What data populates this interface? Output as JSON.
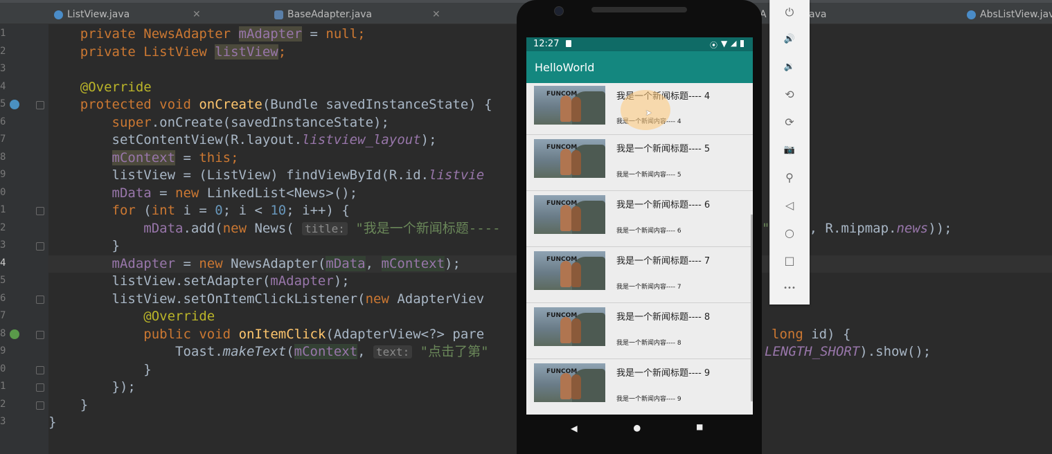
{
  "tabs": [
    {
      "label": "ListView.java",
      "icon": "class-icon"
    },
    {
      "label": "BaseAdapter.java",
      "icon": "interface-icon"
    },
    {
      "label": "A",
      "icon": "class-icon"
    },
    {
      "label": "ava",
      "icon": ""
    },
    {
      "label": "AbsListView.java",
      "icon": "class-icon"
    }
  ],
  "line_numbers": [
    "1",
    "2",
    "3",
    "4",
    "5",
    "6",
    "7",
    "8",
    "9",
    "0",
    "1",
    "2",
    "3",
    "4",
    "5",
    "6",
    "7",
    "8",
    "9",
    "0",
    "1",
    "2",
    "3"
  ],
  "code": {
    "l1_a": "    private NewsAdapter ",
    "l1_b": "mAdapter",
    "l1_c": " = ",
    "l1_d": "null",
    "l1_e": ";",
    "l2_a": "    private ListView ",
    "l2_b": "listView",
    "l2_c": ";",
    "l4": "    @Override",
    "l5_a": "    protected void ",
    "l5_b": "onCreate",
    "l5_c": "(Bundle savedInstanceState) {",
    "l6_a": "        ",
    "l6_b": "super",
    "l6_c": ".onCreate(savedInstanceState);",
    "l7_a": "        setContentView(R.layout.",
    "l7_b": "listview_layout",
    "l7_c": ");",
    "l8_a": "        ",
    "l8_b": "mContext",
    "l8_c": " = ",
    "l8_d": "this",
    "l8_e": ";",
    "l9_a": "        listView = (ListView) findViewById(R.id.",
    "l9_b": "listvie",
    "l10_a": "        ",
    "l10_b": "mData",
    "l10_c": " = ",
    "l10_d": "new",
    "l10_e": " LinkedList<News>();",
    "l11_a": "        ",
    "l11_b": "for",
    "l11_c": " (",
    "l11_d": "int",
    "l11_e": " i = ",
    "l11_f": "0",
    "l11_g": "; i < ",
    "l11_h": "10",
    "l11_i": "; i++) {",
    "l12_a": "            ",
    "l12_b": "mData",
    "l12_c": ".add(",
    "l12_d": "new",
    "l12_e": " News( ",
    "l12_hint": "title:",
    "l12_f": " \"我是一个新闻标题----",
    "l12_r1": "\" + i, R.mipmap.",
    "l12_r2": "news",
    "l12_r3": "));",
    "l13": "        }",
    "l14_a": "        ",
    "l14_b": "mAdapter",
    "l14_c": " = ",
    "l14_d": "new",
    "l14_e": " NewsAdapter(",
    "l14_f": "mData",
    "l14_g": ", ",
    "l14_h": "mContext",
    "l14_i": ");",
    "l15_a": "        listView.setAdapter(",
    "l15_b": "mAdapter",
    "l15_c": ");",
    "l16_a": "        listView.setOnItemClickListener(",
    "l16_b": "new",
    "l16_c": " AdapterViev",
    "l17": "            @Override",
    "l18_a": "            ",
    "l18_b": "public void ",
    "l18_c": "onItemClick",
    "l18_d": "(AdapterView<?> pare",
    "l18_r1": "long",
    "l18_r2": " id) {",
    "l19_a": "                Toast.",
    "l19_b": "makeText",
    "l19_c": "(",
    "l19_d": "mContext",
    "l19_e": ", ",
    "l19_hint": "text:",
    "l19_f": " \"点击了第\"",
    "l19_r1": "LENGTH_SHORT",
    "l19_r2": ").show();",
    "l20": "            }",
    "l21_a": "        });",
    "l22": "    }",
    "l23": "}"
  },
  "phone": {
    "time": "12:27",
    "app_title": "HelloWorld",
    "items": [
      {
        "title": "我是一个新闻标题---- 4",
        "content": "我是一个新闻内容---- 4"
      },
      {
        "title": "我是一个新闻标题---- 5",
        "content": "我是一个新闻内容---- 5"
      },
      {
        "title": "我是一个新闻标题---- 6",
        "content": "我是一个新闻内容---- 6"
      },
      {
        "title": "我是一个新闻标题---- 7",
        "content": "我是一个新闻内容---- 7"
      },
      {
        "title": "我是一个新闻标题---- 8",
        "content": "我是一个新闻内容---- 8"
      },
      {
        "title": "我是一个新闻标题---- 9",
        "content": "我是一个新闻内容---- 9"
      }
    ],
    "thumb_logo": "FUNCOM",
    "nav": {
      "back": "◀",
      "home": "●",
      "recents": "■"
    }
  },
  "emulator_controls": [
    {
      "name": "power-icon",
      "glyph": "⏻"
    },
    {
      "name": "volume-up-icon",
      "glyph": "🔊"
    },
    {
      "name": "volume-down-icon",
      "glyph": "🔉"
    },
    {
      "name": "rotate-left-icon",
      "glyph": "⟲"
    },
    {
      "name": "rotate-right-icon",
      "glyph": "⟳"
    },
    {
      "name": "camera-icon",
      "glyph": "📷"
    },
    {
      "name": "zoom-icon",
      "glyph": "⚲"
    },
    {
      "name": "back-icon",
      "glyph": "◁"
    },
    {
      "name": "home-icon",
      "glyph": "○"
    },
    {
      "name": "overview-icon",
      "glyph": "□"
    },
    {
      "name": "more-icon",
      "glyph": "•••"
    }
  ],
  "colors": {
    "editor_bg": "#2b2b2b",
    "keyword": "#cc7832",
    "field": "#9876aa",
    "app_bar": "#14877f"
  }
}
